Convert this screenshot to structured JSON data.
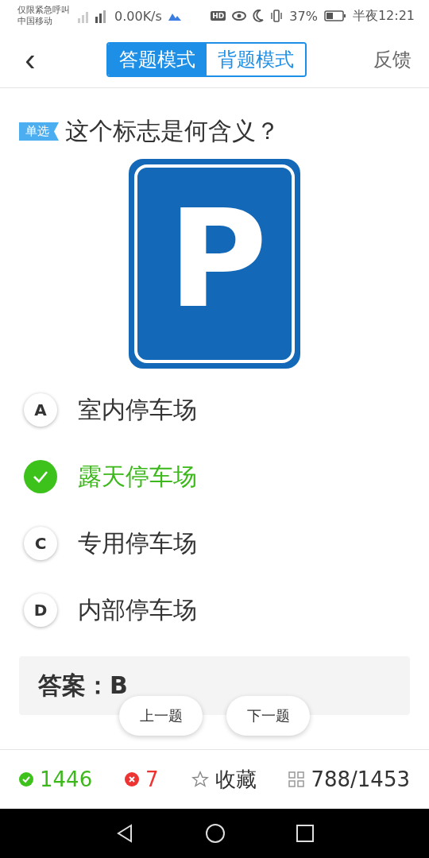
{
  "status_bar": {
    "carrier_lines": [
      "仅限紧急呼叫",
      "中国移动"
    ],
    "speed": "0.00K/s",
    "hd": "HD",
    "battery": "37%",
    "time": "半夜12:21"
  },
  "header": {
    "back": "‹",
    "tabs": [
      {
        "label": "答题模式",
        "selected": true
      },
      {
        "label": "背题模式",
        "selected": false
      }
    ],
    "feedback": "反馈"
  },
  "question": {
    "tag": "单选",
    "text": "这个标志是何含义？",
    "sign": {
      "symbol": "P"
    }
  },
  "options": [
    {
      "letter": "A",
      "text": "室内停车场",
      "correct": false
    },
    {
      "text": "露天停车场",
      "correct": true
    },
    {
      "letter": "C",
      "text": "专用停车场",
      "correct": false
    },
    {
      "letter": "D",
      "text": "内部停车场",
      "correct": false
    }
  ],
  "answer": "答案：B",
  "nav_buttons": [
    "上一题",
    "下一题"
  ],
  "bottom_bar": {
    "right_count": "1446",
    "wrong_count": "7",
    "favorite": "收藏",
    "progress": "788/1453"
  }
}
